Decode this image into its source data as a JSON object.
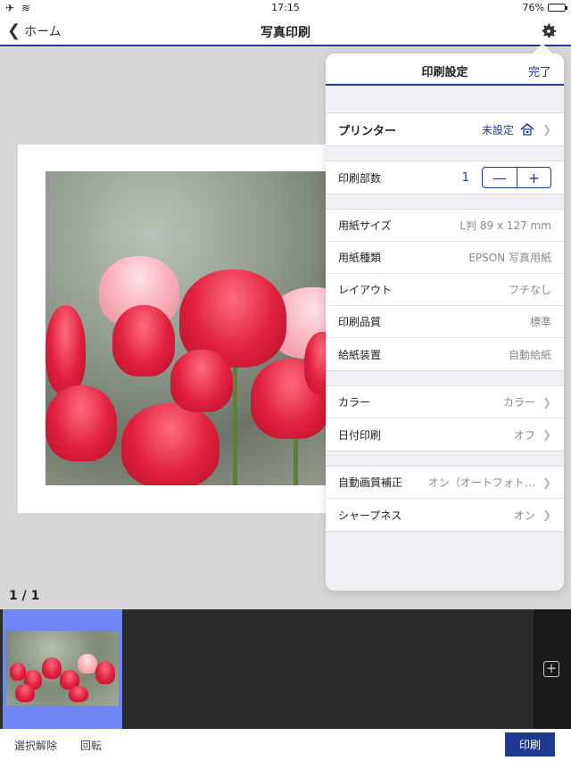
{
  "status_bar": {
    "time": "17:15",
    "battery": "76%",
    "battery_level": 0.76,
    "signal_icons": "✈ ≋"
  },
  "navbar": {
    "back_label": "ホーム",
    "title": "写真印刷"
  },
  "page_indicator": "1 / 1",
  "settings": {
    "title": "印刷設定",
    "done_label": "完了",
    "printer": {
      "label": "プリンター",
      "value": "未設定"
    },
    "copies": {
      "label": "印刷部数",
      "value": "1",
      "minus": "—",
      "plus": "+"
    },
    "paper_group": [
      {
        "label": "用紙サイズ",
        "value": "L判 89 x 127 mm"
      },
      {
        "label": "用紙種類",
        "value": "EPSON 写真用紙"
      },
      {
        "label": "レイアウト",
        "value": "フチなし"
      },
      {
        "label": "印刷品質",
        "value": "標準"
      },
      {
        "label": "給紙装置",
        "value": "自動給紙"
      }
    ],
    "color_group": [
      {
        "label": "カラー",
        "value": "カラー"
      },
      {
        "label": "日付印刷",
        "value": "オフ"
      }
    ],
    "correction_group": [
      {
        "label": "自動画質補正",
        "value": "オン（オートフォト…"
      },
      {
        "label": "シャープネス",
        "value": "オン"
      }
    ]
  },
  "thumbnail_strip": {
    "add_label": "+"
  },
  "toolbar": {
    "deselect_label": "選択解除",
    "rotate_label": "回転",
    "print_label": "印刷"
  },
  "colors": {
    "accent": "#1f3a93",
    "selection": "#6f85f5"
  }
}
